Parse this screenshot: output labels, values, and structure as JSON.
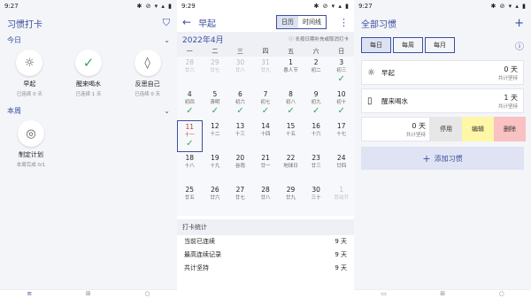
{
  "screen1": {
    "status": {
      "time": "9:27",
      "icons": "✱ ⊘ ▾ ▴ ▮"
    },
    "title": "习惯打卡",
    "sections": [
      {
        "label": "今日",
        "habits": [
          {
            "name": "早起",
            "sub": "已连续 0 天",
            "icon": "sun-icon",
            "glyph": "☼"
          },
          {
            "name": "醒来喝水",
            "sub": "已连续 1 天",
            "icon": "check-icon",
            "glyph": "✓"
          },
          {
            "name": "反思自己",
            "sub": "已连续 0 天",
            "icon": "water-drop-icon",
            "glyph": "◊"
          }
        ]
      },
      {
        "label": "本周",
        "habits": [
          {
            "name": "制定计划",
            "sub": "本周完成 0/1",
            "icon": "target-icon",
            "glyph": "◎"
          }
        ]
      }
    ],
    "nav": [
      "≡",
      "⊞",
      "○"
    ]
  },
  "screen2": {
    "status": {
      "time": "9:29",
      "icons": "✱ ⊘ ▾ ▴ ▮"
    },
    "title": "早起",
    "view_tabs": [
      "日历",
      "时间线"
    ],
    "month": "2022年4月",
    "hint": "ⓘ 长按日期补充或取消打卡",
    "weekdays": [
      "一",
      "二",
      "三",
      "四",
      "五",
      "六",
      "日"
    ],
    "days": [
      {
        "n": "28",
        "l": "廿六",
        "dim": true,
        "chk": false
      },
      {
        "n": "29",
        "l": "廿七",
        "dim": true,
        "chk": false
      },
      {
        "n": "30",
        "l": "廿八",
        "dim": true,
        "chk": false
      },
      {
        "n": "31",
        "l": "廿九",
        "dim": true,
        "chk": false
      },
      {
        "n": "1",
        "l": "愚人节",
        "dim": false,
        "chk": false
      },
      {
        "n": "2",
        "l": "初二",
        "dim": false,
        "chk": false
      },
      {
        "n": "3",
        "l": "初三",
        "dim": false,
        "chk": true
      },
      {
        "n": "4",
        "l": "初四",
        "dim": false,
        "chk": true
      },
      {
        "n": "5",
        "l": "清明",
        "dim": false,
        "chk": true
      },
      {
        "n": "6",
        "l": "初六",
        "dim": false,
        "chk": true
      },
      {
        "n": "7",
        "l": "初七",
        "dim": false,
        "chk": true
      },
      {
        "n": "8",
        "l": "初八",
        "dim": false,
        "chk": true
      },
      {
        "n": "9",
        "l": "初九",
        "dim": false,
        "chk": true
      },
      {
        "n": "10",
        "l": "初十",
        "dim": false,
        "chk": true
      },
      {
        "n": "11",
        "l": "十一",
        "dim": false,
        "chk": true,
        "today": true
      },
      {
        "n": "12",
        "l": "十二",
        "dim": false,
        "chk": false
      },
      {
        "n": "13",
        "l": "十三",
        "dim": false,
        "chk": false
      },
      {
        "n": "14",
        "l": "十四",
        "dim": false,
        "chk": false
      },
      {
        "n": "15",
        "l": "十五",
        "dim": false,
        "chk": false
      },
      {
        "n": "16",
        "l": "十六",
        "dim": false,
        "chk": false
      },
      {
        "n": "17",
        "l": "十七",
        "dim": false,
        "chk": false
      },
      {
        "n": "18",
        "l": "十八",
        "dim": false,
        "chk": false
      },
      {
        "n": "19",
        "l": "十九",
        "dim": false,
        "chk": false
      },
      {
        "n": "20",
        "l": "谷雨",
        "dim": false,
        "chk": false
      },
      {
        "n": "21",
        "l": "廿一",
        "dim": false,
        "chk": false
      },
      {
        "n": "22",
        "l": "地球日",
        "dim": false,
        "chk": false
      },
      {
        "n": "23",
        "l": "廿三",
        "dim": false,
        "chk": false
      },
      {
        "n": "24",
        "l": "廿四",
        "dim": false,
        "chk": false
      },
      {
        "n": "25",
        "l": "廿五",
        "dim": false,
        "chk": false
      },
      {
        "n": "26",
        "l": "廿六",
        "dim": false,
        "chk": false
      },
      {
        "n": "27",
        "l": "廿七",
        "dim": false,
        "chk": false
      },
      {
        "n": "28",
        "l": "廿八",
        "dim": false,
        "chk": false
      },
      {
        "n": "29",
        "l": "廿九",
        "dim": false,
        "chk": false
      },
      {
        "n": "30",
        "l": "三十",
        "dim": false,
        "chk": false
      },
      {
        "n": "1",
        "l": "劳动节",
        "dim": true,
        "chk": false
      }
    ],
    "stats_header": "打卡统计",
    "stats": [
      {
        "label": "当前已连续",
        "value": "9 天"
      },
      {
        "label": "最高连续记录",
        "value": "9 天"
      },
      {
        "label": "共计坚持",
        "value": "9 天"
      }
    ]
  },
  "screen3": {
    "status": {
      "time": "9:27",
      "icons": "✱ ⊘ ▾ ▴ ▮"
    },
    "title": "全部习惯",
    "tabs": [
      "每日",
      "每周",
      "每月"
    ],
    "habits": [
      {
        "name": "早起",
        "count": "0 天",
        "sub": "共计坚持",
        "glyph": "☼"
      },
      {
        "name": "醒来喝水",
        "count": "1 天",
        "sub": "共计坚持",
        "glyph": "▯"
      }
    ],
    "swiped": {
      "count": "0 天",
      "sub": "共计坚持",
      "stop": "停用",
      "edit": "编辑",
      "delete": "删除"
    },
    "add_label": "添加习惯",
    "nav": [
      "▭",
      "⊞",
      "○"
    ]
  }
}
